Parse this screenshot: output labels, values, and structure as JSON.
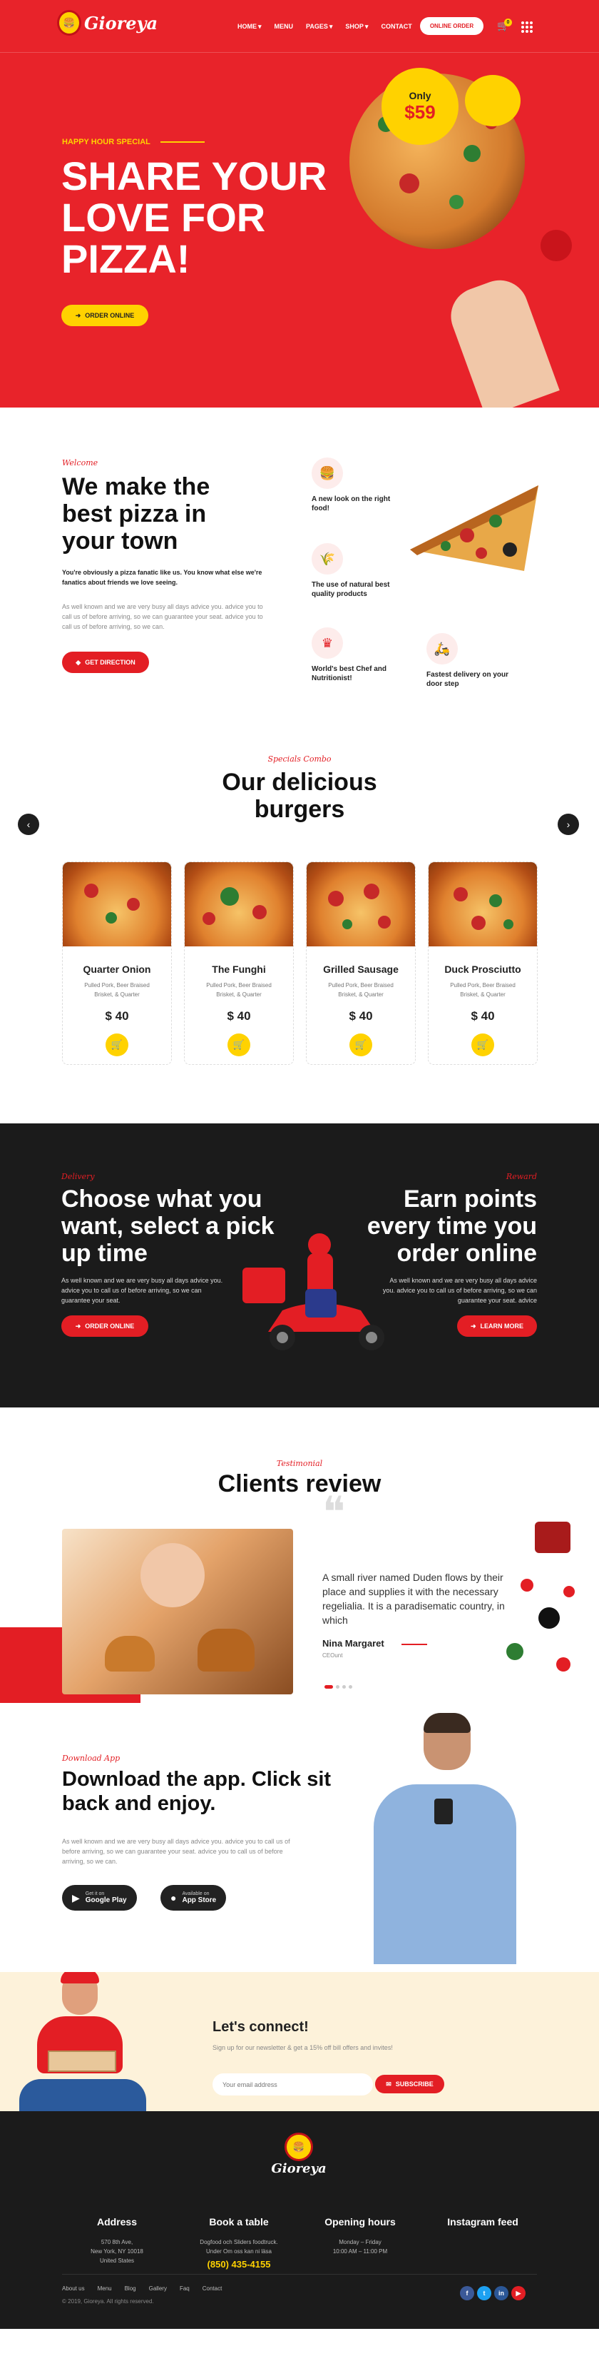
{
  "brand": {
    "name": "Gioreya",
    "logo_icon": "burger-logo-icon"
  },
  "nav": {
    "items": [
      "HOME",
      "MENU",
      "PAGES",
      "SHOP",
      "CONTACT"
    ],
    "order_button": "ONLINE ORDER",
    "cart_count": "0"
  },
  "hero": {
    "subtitle": "HAPPY HOUR SPECIAL",
    "title": "SHARE YOUR LOVE FOR PIZZA!",
    "button": "ORDER ONLINE",
    "badge_only": "Only",
    "badge_price": "$59"
  },
  "welcome": {
    "tag": "Welcome",
    "title": "We make the best pizza in your town",
    "bold_text": "You're obviously a pizza fanatic like us. You know what else we're fanatics about friends we love seeing.",
    "gray_text": "As well known and we are very busy all days advice you. advice you to call us of before arriving, so we can guarantee your seat. advice you to call us of before arriving, so we can.",
    "button": "GET DIRECTION",
    "features": [
      {
        "icon": "burger-icon",
        "text": "A new look on the right food!"
      },
      {
        "icon": "wheat-icon",
        "text": "The use of natural best quality products"
      },
      {
        "icon": "chef-hat-icon",
        "text": "World's best Chef and Nutritionist!"
      },
      {
        "icon": "delivery-scooter-icon",
        "text": "Fastest delivery on your door step"
      }
    ]
  },
  "combo": {
    "tag": "Specials Combo",
    "title": "Our delicious burgers",
    "items": [
      {
        "name": "Quarter Onion",
        "desc": "Pulled Pork, Beer Braised Brisket, & Quarter",
        "price": "$ 40"
      },
      {
        "name": "The Funghi",
        "desc": "Pulled Pork, Beer Braised Brisket, & Quarter",
        "price": "$ 40"
      },
      {
        "name": "Grilled Sausage",
        "desc": "Pulled Pork, Beer Braised Brisket, & Quarter",
        "price": "$ 40"
      },
      {
        "name": "Duck Prosciutto",
        "desc": "Pulled Pork, Beer Braised Brisket, & Quarter",
        "price": "$ 40"
      }
    ]
  },
  "delivery": {
    "left_tag": "Delivery",
    "left_title": "Choose what you want, select a pick up time",
    "left_text": "As well known and we are very busy all days advice you. advice you to call us of before arriving, so we can guarantee your seat.",
    "left_button": "ORDER ONLINE",
    "right_tag": "Reward",
    "right_title": "Earn points every time you order online",
    "right_text": "As well known and we are very busy all days advice you. advice you to call us of before arriving, so we can guarantee your seat. advice",
    "right_button": "LEARN MORE"
  },
  "testimonial": {
    "tag": "Testimonial",
    "title": "Clients review",
    "quote": "A small river named Duden flows by their place and supplies it with the necessary regelialia. It is a paradisematic country, in which",
    "name": "Nina Margaret",
    "role": "CEOunt"
  },
  "app": {
    "tag": "Download App",
    "title": "Download the app. Click sit back and enjoy.",
    "text": "As well known and we are very busy all days advice you. advice you to call us of before arriving, so we can guarantee your seat. advice you to call us of before arriving, so we can.",
    "google_small": "Get it on",
    "google_big": "Google Play",
    "apple_small": "Available on",
    "apple_big": "App Store"
  },
  "connect": {
    "title": "Let's connect!",
    "subtitle": "Sign up for our newsletter & get a 15% off bill offers and invites!",
    "placeholder": "Your email address",
    "button": "SUBSCRIBE"
  },
  "footer": {
    "columns": [
      {
        "title": "Address",
        "lines": [
          "570 8th Ave,",
          "New York, NY 10018",
          "United States"
        ]
      },
      {
        "title": "Book a table",
        "lines": [
          "Dogfood och Sliders foodtruck.",
          "Under Om oss kan ni läsa"
        ],
        "phone": "(850) 435-4155"
      },
      {
        "title": "Opening hours",
        "lines": [
          "Monday – Friday",
          "10:00 AM – 11:00 PM"
        ]
      },
      {
        "title": "Instagram feed",
        "lines": []
      }
    ],
    "links": [
      "About us",
      "Menu",
      "Blog",
      "Gallery",
      "Faq",
      "Contact"
    ],
    "copyright": "© 2019, Gioreya. All rights reserved.",
    "social": [
      {
        "icon": "facebook-icon",
        "letter": "f",
        "color": "#3b5998"
      },
      {
        "icon": "twitter-icon",
        "letter": "t",
        "color": "#1da1f2"
      },
      {
        "icon": "instagram-icon",
        "letter": "in",
        "color": "#2b5797"
      },
      {
        "icon": "youtube-icon",
        "letter": "▶",
        "color": "#e31e24"
      }
    ]
  }
}
